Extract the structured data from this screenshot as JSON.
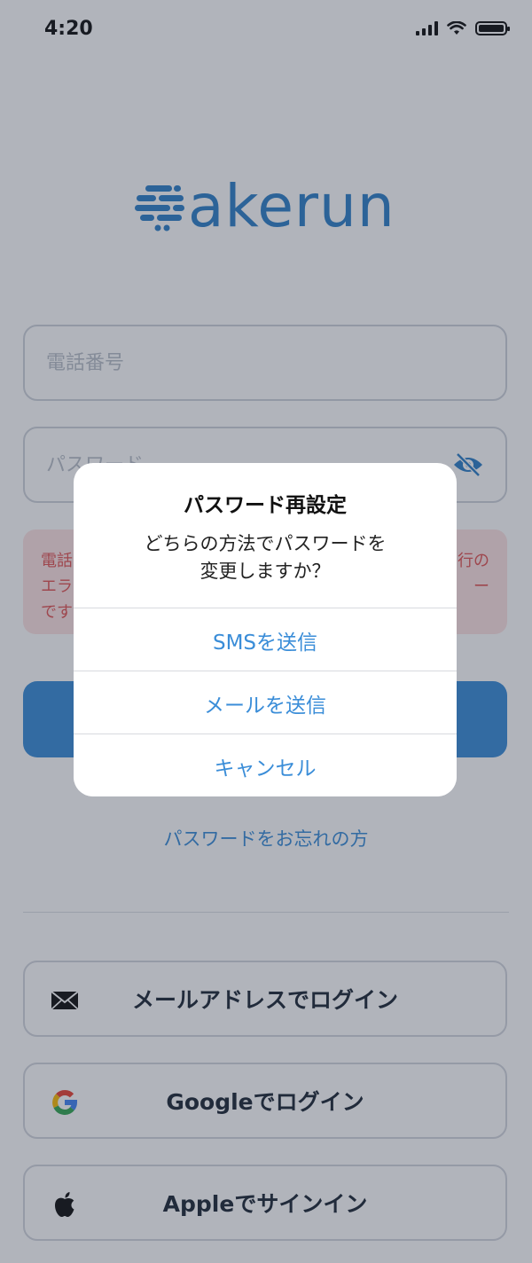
{
  "status_bar": {
    "time": "4:20"
  },
  "logo": {
    "text": "akerun",
    "color": "#2f80c9"
  },
  "phone_field": {
    "placeholder": "電話番号"
  },
  "password_field": {
    "placeholder": "パスワード"
  },
  "error": {
    "line1_left": "電話",
    "line1_right": "行の",
    "line2_left": "エラ",
    "line2_right": "ー",
    "line3_left": "です"
  },
  "forgot_password_link": "パスワードをお忘れの方",
  "social_buttons": {
    "email": "メールアドレスでログイン",
    "google": "Googleでログイン",
    "apple": "Appleでサインイン"
  },
  "alert": {
    "title": "パスワード再設定",
    "message_line1": "どちらの方法でパスワードを",
    "message_line2": "変更しますか？",
    "actions": [
      "SMSを送信",
      "メールを送信",
      "キャンセル"
    ]
  },
  "colors": {
    "accent": "#3a8dd8",
    "error_bg": "#fde3e3",
    "error_text": "#e25555"
  }
}
